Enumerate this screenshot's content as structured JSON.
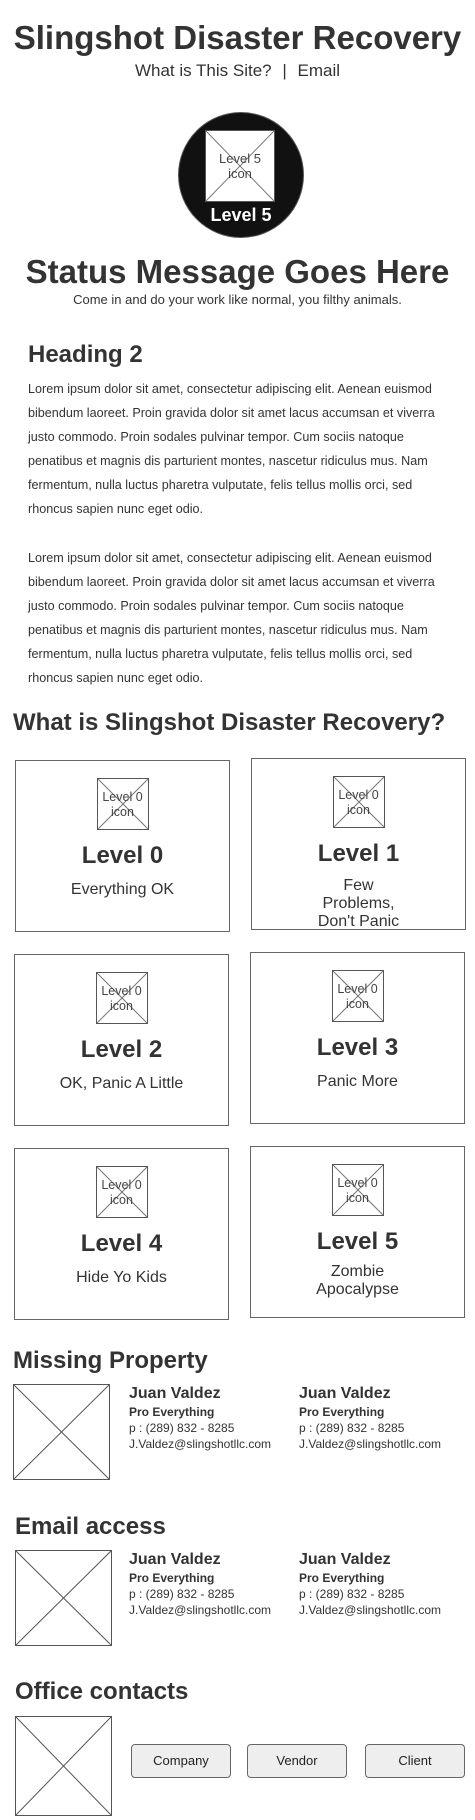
{
  "header": {
    "title": "Slingshot Disaster Recovery",
    "nav_about": "What is This Site?",
    "nav_separator": "|",
    "nav_email": "Email"
  },
  "status": {
    "icon_label": "Level 5 icon",
    "level_label": "Level 5",
    "message": "Status Message Goes Here",
    "submessage": "Come in and do your work like normal, you filthy animals."
  },
  "content": {
    "heading": "Heading 2",
    "paragraphs": [
      "Lorem ipsum dolor sit amet, consectetur adipiscing elit. Aenean euismod bibendum laoreet. Proin gravida dolor sit amet lacus accumsan et viverra justo commodo. Proin sodales pulvinar tempor. Cum sociis natoque penatibus et magnis dis parturient montes, nascetur ridiculus mus. Nam fermentum, nulla luctus pharetra vulputate, felis tellus mollis orci, sed rhoncus sapien nunc eget odio.",
      "Lorem ipsum dolor sit amet, consectetur adipiscing elit. Aenean euismod bibendum laoreet. Proin gravida dolor sit amet lacus accumsan et viverra justo commodo. Proin sodales pulvinar tempor. Cum sociis natoque penatibus et magnis dis parturient montes, nascetur ridiculus mus. Nam fermentum, nulla luctus pharetra vulputate, felis tellus mollis orci, sed rhoncus sapien nunc eget odio."
    ]
  },
  "levels": {
    "title": "What is Slingshot Disaster Recovery?",
    "cards": [
      {
        "icon_label": "Level 0 icon",
        "title": "Level 0",
        "description": "Everything OK"
      },
      {
        "icon_label": "Level 0 icon",
        "title": "Level 1",
        "description": "Few Problems, Don't Panic"
      },
      {
        "icon_label": "Level 0 icon",
        "title": "Level 2",
        "description": "OK, Panic A Little"
      },
      {
        "icon_label": "Level 0 icon",
        "title": "Level 3",
        "description": "Panic More"
      },
      {
        "icon_label": "Level 0 icon",
        "title": "Level 4",
        "description": "Hide Yo Kids"
      },
      {
        "icon_label": "Level 0 icon",
        "title": "Level 5",
        "description": "Zombie Apocalypse"
      }
    ]
  },
  "missing_property": {
    "title": "Missing Property",
    "contacts": [
      {
        "name": "Juan Valdez",
        "role": "Pro Everything",
        "phone": "p : (289) 832 - 8285",
        "email": "J.Valdez@slingshotllc.com"
      },
      {
        "name": "Juan Valdez",
        "role": "Pro Everything",
        "phone": "p : (289) 832 - 8285",
        "email": "J.Valdez@slingshotllc.com"
      }
    ]
  },
  "email_access": {
    "title": "Email access",
    "contacts": [
      {
        "name": "Juan Valdez",
        "role": "Pro Everything",
        "phone": "p : (289) 832 - 8285",
        "email": "J.Valdez@slingshotllc.com"
      },
      {
        "name": "Juan Valdez",
        "role": "Pro Everything",
        "phone": "p : (289) 832 - 8285",
        "email": "J.Valdez@slingshotllc.com"
      }
    ]
  },
  "office_contacts": {
    "title": "Office contacts",
    "buttons": [
      "Company",
      "Vendor",
      "Client"
    ]
  }
}
